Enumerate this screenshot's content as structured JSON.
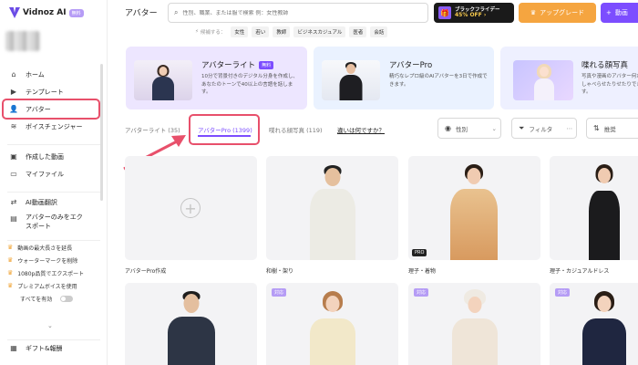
{
  "app": {
    "name": "Vidnoz AI",
    "badge": "無料"
  },
  "colors": {
    "accent": "#7c4dff",
    "highlight": "#e8506b",
    "orange": "#f5a540"
  },
  "sidebar": {
    "nav": [
      {
        "icon": "home-icon",
        "label": "ホーム"
      },
      {
        "icon": "template-icon",
        "label": "テンプレート"
      },
      {
        "icon": "avatar-icon",
        "label": "アバター",
        "active": true
      },
      {
        "icon": "voice-icon",
        "label": "ボイスチェンジャー"
      }
    ],
    "nav2": [
      {
        "icon": "video-icon",
        "label": "作成した動画"
      },
      {
        "icon": "file-icon",
        "label": "マイファイル"
      }
    ],
    "nav3": [
      {
        "icon": "translate-icon",
        "label": "AI動画翻訳"
      },
      {
        "icon": "export-icon",
        "label": "アバターのみをエクスポート"
      }
    ],
    "perks": [
      "動画の最大長さを延長",
      "ウォーターマークを削除",
      "1080p品質でエクスポート",
      "プレミアムボイスを使用"
    ],
    "enable_all": "すべてを有効",
    "footer": "ギフト&報酬"
  },
  "header": {
    "title": "アバター",
    "search_placeholder": "性別、職業、または服で検索 例：女性教師",
    "black_friday": {
      "title": "ブラックフライデー",
      "off": "45% OFF ›"
    },
    "upgrade": "アップグレード",
    "create": "動画"
  },
  "tags": {
    "label": "候補する：",
    "items": [
      "女性",
      "若い",
      "教師",
      "ビジネスカジュアル",
      "医者",
      "会話"
    ]
  },
  "banners": [
    {
      "title": "アバターライト",
      "badge": "無料",
      "desc": "10分で背景付きのデジタル分身を作成し、あなたのトーンで40以上の言語を話します。"
    },
    {
      "title": "アバターPro",
      "desc": "精巧なレプロ級のAIアバターを3日で作成できます。"
    },
    {
      "title": "喋れる顔写真",
      "desc": "写真や漫画のアバター何かをしゃべらせたりせたりできます。"
    }
  ],
  "tabs": {
    "lite": "アバターライト (35)",
    "pro": "アバターPro (1399)",
    "face": "喋れる顔写真 (119)",
    "what": "違いは何ですか？"
  },
  "filters": {
    "gender": "性別",
    "filter": "フィルタ",
    "sort": "推奨"
  },
  "cards": {
    "row1": [
      {
        "label": "アバターPro作成"
      },
      {
        "label": "和樹・架り"
      },
      {
        "label": "理子・着物",
        "badge": "PRO"
      },
      {
        "label": "理子・カジュアルドレス"
      }
    ],
    "face_badge": "対応"
  }
}
